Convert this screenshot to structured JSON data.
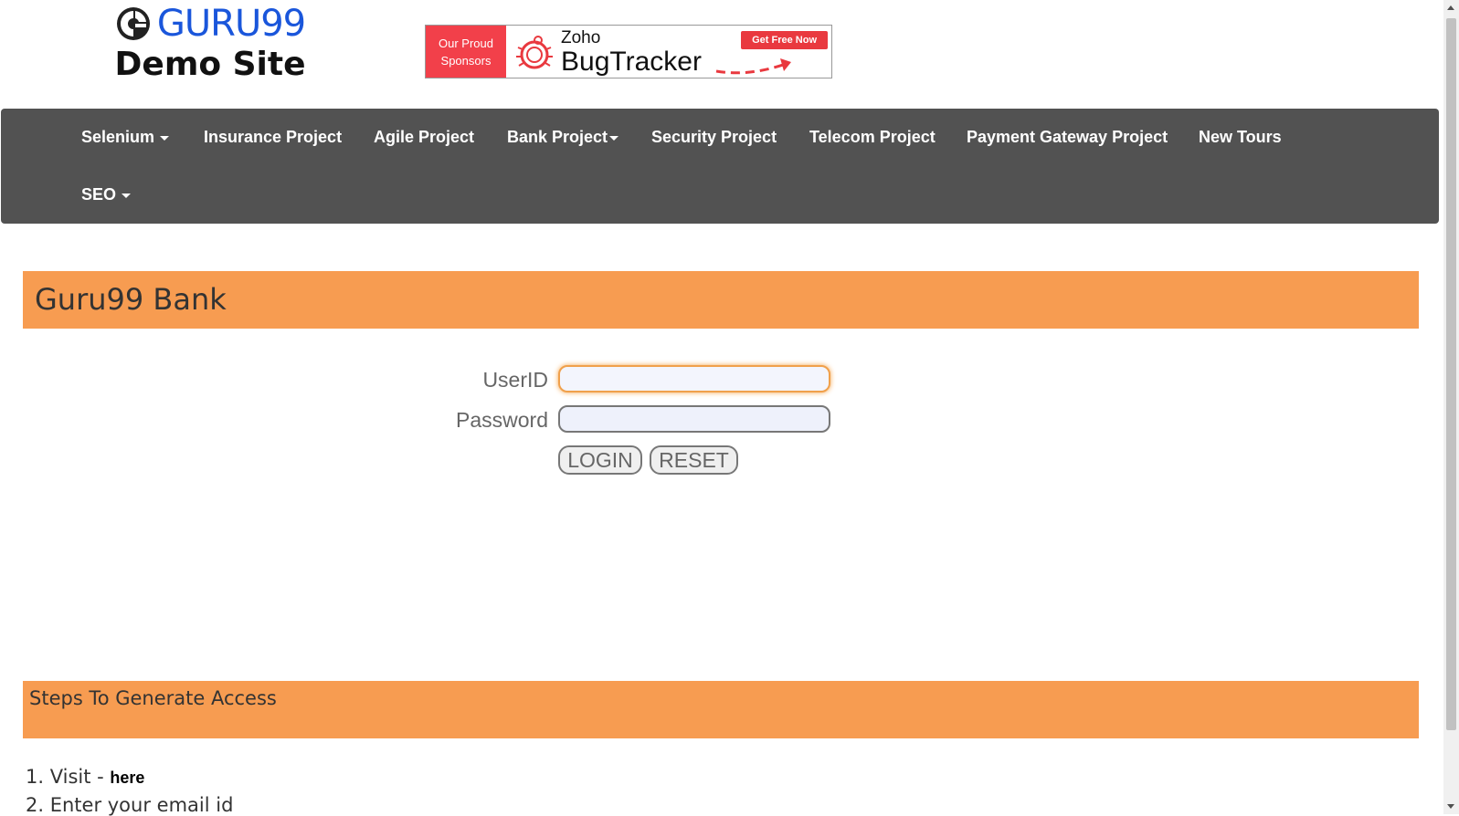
{
  "header": {
    "logo_text": "GURU99",
    "logo_subtitle": "Demo Site",
    "sponsor_banner": {
      "left_line1": "Our Proud",
      "left_line2": "Sponsors",
      "brand_small": "Zoho",
      "brand_large": "BugTracker",
      "cta": "Get Free Now",
      "icon": "bug-icon"
    }
  },
  "nav": {
    "items": [
      {
        "label": "Selenium",
        "dropdown": true
      },
      {
        "label": "Insurance Project",
        "dropdown": false
      },
      {
        "label": "Agile Project",
        "dropdown": false
      },
      {
        "label": "Bank Project",
        "dropdown": true
      },
      {
        "label": "Security Project",
        "dropdown": false
      },
      {
        "label": "Telecom Project",
        "dropdown": false
      },
      {
        "label": "Payment Gateway Project",
        "dropdown": false
      },
      {
        "label": "New Tours",
        "dropdown": false
      },
      {
        "label": "SEO",
        "dropdown": true
      }
    ]
  },
  "bank": {
    "title": "Guru99 Bank",
    "userid_label": "UserID",
    "userid_value": "",
    "password_label": "Password",
    "password_value": "",
    "login_label": "LOGIN",
    "reset_label": "RESET"
  },
  "steps": {
    "title": "Steps To Generate Access",
    "items": [
      {
        "prefix": "1. Visit - ",
        "link": "here"
      },
      {
        "prefix": "2. Enter your email id",
        "link": ""
      }
    ]
  },
  "colors": {
    "nav_bg": "#525252",
    "section_bg": "#f79c51",
    "logo_blue": "#1a56db"
  }
}
